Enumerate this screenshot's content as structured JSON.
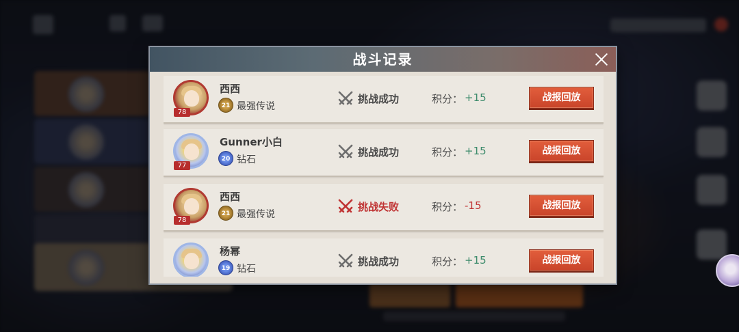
{
  "modal": {
    "title": "战斗记录",
    "close_icon": "close-icon"
  },
  "score_label": "积分：",
  "replay_label": "战报回放",
  "records": [
    {
      "name": "西西",
      "level": "78",
      "avatar_frame": "red",
      "rank_badge_level": "21",
      "rank_badge_style": "gold",
      "rank": "最强传说",
      "result": "挑战成功",
      "result_type": "win",
      "score": "+15"
    },
    {
      "name": "Gunner小白",
      "level": "77",
      "avatar_frame": "blue",
      "rank_badge_level": "20",
      "rank_badge_style": "blue",
      "rank": "钻石",
      "result": "挑战成功",
      "result_type": "win",
      "score": "+15"
    },
    {
      "name": "西西",
      "level": "78",
      "avatar_frame": "red",
      "rank_badge_level": "21",
      "rank_badge_style": "gold",
      "rank": "最强传说",
      "result": "挑战失败",
      "result_type": "lose",
      "score": "-15"
    },
    {
      "name": "杨幂",
      "level": "",
      "avatar_frame": "blue",
      "rank_badge_level": "19",
      "rank_badge_style": "blue",
      "rank": "钻石",
      "result": "挑战成功",
      "result_type": "win",
      "score": "+15"
    }
  ],
  "colors": {
    "win_icon": "#6e6e6e",
    "lose_icon": "#c03434",
    "score_plus": "#3b8a6a",
    "score_minus": "#c03434",
    "replay_button": "#d24f32"
  }
}
